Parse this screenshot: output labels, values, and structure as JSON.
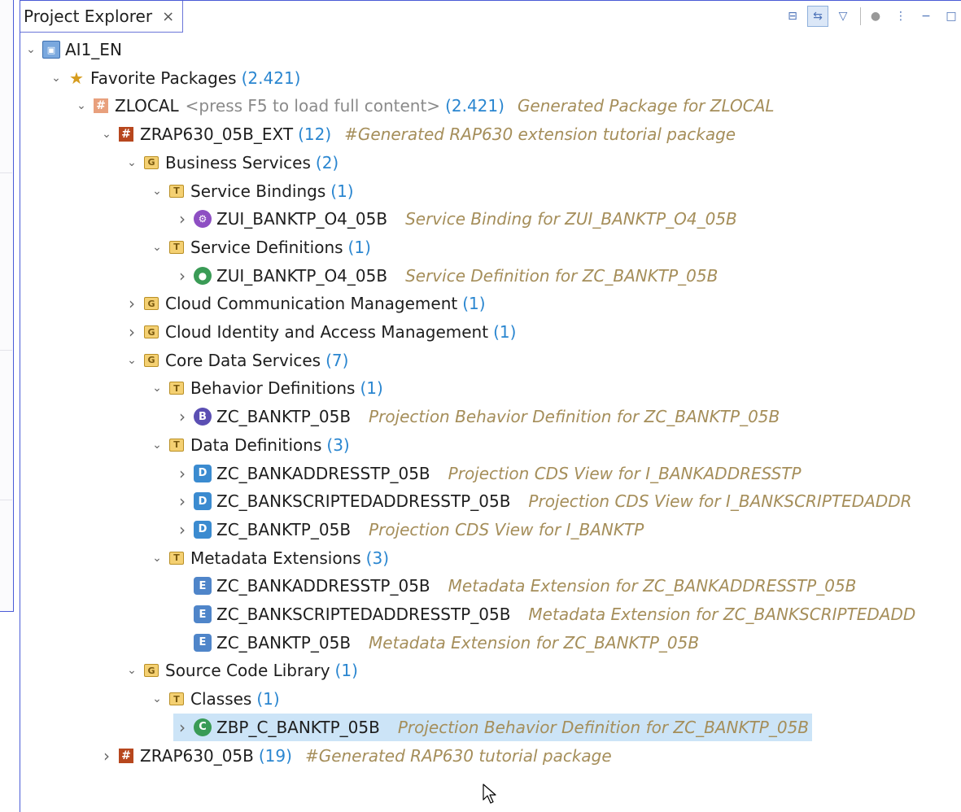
{
  "view": {
    "title": "Project Explorer",
    "close_glyph": "×",
    "toolbar": [
      {
        "name": "collapse-all-icon",
        "glyph": "⊟",
        "pressed": false
      },
      {
        "name": "link-with-editor-icon",
        "glyph": "⇆",
        "pressed": true
      },
      {
        "name": "filter-icon",
        "glyph": "▽",
        "pressed": false
      },
      {
        "name": "separator",
        "glyph": "",
        "pressed": false
      },
      {
        "name": "focus-icon",
        "glyph": "●",
        "pressed": false
      },
      {
        "name": "view-menu-icon",
        "glyph": "⋮",
        "pressed": false
      },
      {
        "name": "minimize-icon",
        "glyph": "−",
        "pressed": false
      },
      {
        "name": "maximize-icon",
        "glyph": "□",
        "pressed": false
      }
    ]
  },
  "tree": [
    {
      "level": 0,
      "twisty": "open",
      "icon": "project",
      "glyph": "▣",
      "label": "AI1_EN",
      "count": "",
      "hint": "",
      "desc": ""
    },
    {
      "level": 1,
      "twisty": "open",
      "icon": "star",
      "glyph": "★",
      "label": "Favorite Packages",
      "count": "(2.421)",
      "hint": "",
      "desc": ""
    },
    {
      "level": 2,
      "twisty": "open",
      "icon": "pkgtrans",
      "glyph": "#",
      "label": "ZLOCAL",
      "count": "(2.421)",
      "hint": "<press F5 to load full content>",
      "desc": "Generated Package for ZLOCAL"
    },
    {
      "level": 3,
      "twisty": "open",
      "icon": "pkg",
      "glyph": "#",
      "label": "ZRAP630_05B_EXT",
      "count": "(12)",
      "hint": "",
      "desc": "#Generated RAP630  extension tutorial package"
    },
    {
      "level": 4,
      "twisty": "open",
      "icon": "folder",
      "glyph": "G",
      "label": "Business Services",
      "count": "(2)",
      "hint": "",
      "desc": ""
    },
    {
      "level": 5,
      "twisty": "open",
      "icon": "type",
      "glyph": "T",
      "label": "Service Bindings",
      "count": "(1)",
      "hint": "",
      "desc": ""
    },
    {
      "level": 6,
      "twisty": "closed",
      "icon": "svcb",
      "glyph": "⚙",
      "label": "ZUI_BANKTP_O4_05B",
      "count": "",
      "hint": "",
      "desc": "Service Binding for ZUI_BANKTP_O4_05B"
    },
    {
      "level": 5,
      "twisty": "open",
      "icon": "type",
      "glyph": "T",
      "label": "Service Definitions",
      "count": "(1)",
      "hint": "",
      "desc": ""
    },
    {
      "level": 6,
      "twisty": "closed",
      "icon": "svcd",
      "glyph": "●",
      "label": "ZUI_BANKTP_O4_05B",
      "count": "",
      "hint": "",
      "desc": "Service Definition for ZC_BANKTP_05B"
    },
    {
      "level": 4,
      "twisty": "closed",
      "icon": "folder",
      "glyph": "G",
      "label": "Cloud Communication Management",
      "count": "(1)",
      "hint": "",
      "desc": ""
    },
    {
      "level": 4,
      "twisty": "closed",
      "icon": "folder",
      "glyph": "G",
      "label": "Cloud Identity and Access Management",
      "count": "(1)",
      "hint": "",
      "desc": ""
    },
    {
      "level": 4,
      "twisty": "open",
      "icon": "folder",
      "glyph": "G",
      "label": "Core Data Services",
      "count": "(7)",
      "hint": "",
      "desc": ""
    },
    {
      "level": 5,
      "twisty": "open",
      "icon": "type",
      "glyph": "T",
      "label": "Behavior Definitions",
      "count": "(1)",
      "hint": "",
      "desc": ""
    },
    {
      "level": 6,
      "twisty": "closed",
      "icon": "bdef",
      "glyph": "B",
      "label": "ZC_BANKTP_05B",
      "count": "",
      "hint": "",
      "desc": "Projection Behavior Definition for ZC_BANKTP_05B"
    },
    {
      "level": 5,
      "twisty": "open",
      "icon": "type",
      "glyph": "T",
      "label": "Data Definitions",
      "count": "(3)",
      "hint": "",
      "desc": ""
    },
    {
      "level": 6,
      "twisty": "closed",
      "icon": "ddef",
      "glyph": "D",
      "label": "ZC_BANKADDRESSTP_05B",
      "count": "",
      "hint": "",
      "desc": "Projection CDS View for I_BANKADDRESSTP"
    },
    {
      "level": 6,
      "twisty": "closed",
      "icon": "ddef",
      "glyph": "D",
      "label": "ZC_BANKSCRIPTEDADDRESSTP_05B",
      "count": "",
      "hint": "",
      "desc": "Projection CDS View for I_BANKSCRIPTEDADDR"
    },
    {
      "level": 6,
      "twisty": "closed",
      "icon": "ddef",
      "glyph": "D",
      "label": "ZC_BANKTP_05B",
      "count": "",
      "hint": "",
      "desc": "Projection CDS View for I_BANKTP"
    },
    {
      "level": 5,
      "twisty": "open",
      "icon": "type",
      "glyph": "T",
      "label": "Metadata Extensions",
      "count": "(3)",
      "hint": "",
      "desc": ""
    },
    {
      "level": 6,
      "twisty": "none",
      "icon": "mext",
      "glyph": "E",
      "label": "ZC_BANKADDRESSTP_05B",
      "count": "",
      "hint": "",
      "desc": "Metadata Extension for ZC_BANKADDRESSTP_05B"
    },
    {
      "level": 6,
      "twisty": "none",
      "icon": "mext",
      "glyph": "E",
      "label": "ZC_BANKSCRIPTEDADDRESSTP_05B",
      "count": "",
      "hint": "",
      "desc": "Metadata Extension for ZC_BANKSCRIPTEDADD"
    },
    {
      "level": 6,
      "twisty": "none",
      "icon": "mext",
      "glyph": "E",
      "label": "ZC_BANKTP_05B",
      "count": "",
      "hint": "",
      "desc": "Metadata Extension for ZC_BANKTP_05B"
    },
    {
      "level": 4,
      "twisty": "open",
      "icon": "folder",
      "glyph": "G",
      "label": "Source Code Library",
      "count": "(1)",
      "hint": "",
      "desc": ""
    },
    {
      "level": 5,
      "twisty": "open",
      "icon": "type",
      "glyph": "T",
      "label": "Classes",
      "count": "(1)",
      "hint": "",
      "desc": ""
    },
    {
      "level": 6,
      "twisty": "closed",
      "icon": "cls",
      "glyph": "C",
      "label": "ZBP_C_BANKTP_05B",
      "count": "",
      "hint": "",
      "desc": "Projection Behavior Definition for ZC_BANKTP_05B",
      "selected": true
    },
    {
      "level": 3,
      "twisty": "closed",
      "icon": "pkg",
      "glyph": "#",
      "label": "ZRAP630_05B",
      "count": "(19)",
      "hint": "",
      "desc": "#Generated RAP630  tutorial package"
    }
  ]
}
